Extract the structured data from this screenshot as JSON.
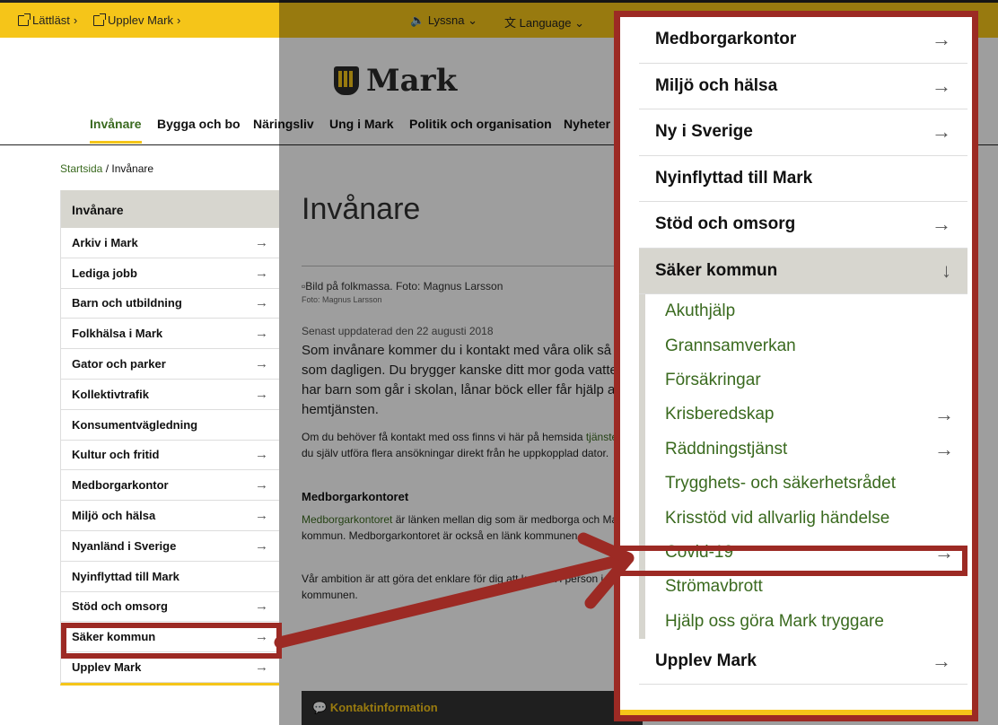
{
  "topbar": {
    "lattlast": "Lättläst",
    "upplev": "Upplev Mark",
    "lyssna": "Lyssna",
    "language": "Language"
  },
  "logo": {
    "name": "Mark"
  },
  "nav": [
    "Invånare",
    "Bygga och bo",
    "Näringsliv",
    "Ung i Mark",
    "Politik och organisation",
    "Nyheter"
  ],
  "breadcrumb": {
    "home": "Startsida",
    "current": "Invånare"
  },
  "sidebar": {
    "heading": "Invånare",
    "items": [
      {
        "label": "Arkiv i Mark",
        "arrow": true
      },
      {
        "label": "Lediga jobb",
        "arrow": true
      },
      {
        "label": "Barn och utbildning",
        "arrow": true
      },
      {
        "label": "Folkhälsa i Mark",
        "arrow": true
      },
      {
        "label": "Gator och parker",
        "arrow": true
      },
      {
        "label": "Kollektivtrafik",
        "arrow": true
      },
      {
        "label": "Konsumentvägledning",
        "arrow": false
      },
      {
        "label": "Kultur och fritid",
        "arrow": true
      },
      {
        "label": "Medborgarkontor",
        "arrow": true
      },
      {
        "label": "Miljö och hälsa",
        "arrow": true
      },
      {
        "label": "Nyanländ i Sverige",
        "arrow": true
      },
      {
        "label": "Nyinflyttad till Mark",
        "arrow": false
      },
      {
        "label": "Stöd och omsorg",
        "arrow": true
      },
      {
        "label": "Säker kommun",
        "arrow": true
      },
      {
        "label": "Upplev Mark",
        "arrow": true
      }
    ]
  },
  "content": {
    "title": "Invånare",
    "img_alt": "Bild på folkmassa. Foto: Magnus Larsson",
    "img_caption": "Foto: Magnus Larsson",
    "updated": "Senast uppdaterad den 22 augusti 2018",
    "lead": "Som invånare kommer du i kontakt med våra olik så gott som dagligen. Du brygger kanske ditt mor goda vatten, har barn som går i skolan, lånar böck eller får hjälp av hemtjänsten.",
    "p1_start": "Om du behöver få kontakt med oss finns vi här på hemsida",
    "p1_link": "tjänster",
    "p1_end": " kan du själv utföra flera ansökningar direkt från he uppkopplad dator.",
    "h3": "Medborgarkontoret",
    "p2_link": "Medborgarkontoret",
    "p2_rest": " är länken mellan dig som är medborga och Marks kommun. Medborgarkontoret är också en länk kommunen.",
    "p3": "Vår ambition är att göra det enklare för dig att komma i person i kommunen.",
    "kontakt": "Kontaktinformation"
  },
  "zoom": {
    "items": [
      {
        "label": "Medborgarkontor",
        "arrow": true
      },
      {
        "label": "Miljö och hälsa",
        "arrow": true
      },
      {
        "label": "Ny i Sverige",
        "arrow": true
      },
      {
        "label": "Nyinflyttad till Mark",
        "arrow": false
      },
      {
        "label": "Stöd och omsorg",
        "arrow": true
      }
    ],
    "open_item": "Säker kommun",
    "sub_items": [
      {
        "label": "Akuthjälp",
        "arrow": false
      },
      {
        "label": "Grannsamverkan",
        "arrow": false
      },
      {
        "label": "Försäkringar",
        "arrow": false
      },
      {
        "label": "Krisberedskap",
        "arrow": true
      },
      {
        "label": "Räddningstjänst",
        "arrow": true
      },
      {
        "label": "Trygghets- och säkerhetsrådet",
        "arrow": false
      },
      {
        "label": "Krisstöd vid allvarlig händelse",
        "arrow": false
      },
      {
        "label": "Covid-19",
        "arrow": true
      },
      {
        "label": "Strömavbrott",
        "arrow": false
      },
      {
        "label": "Hjälp oss göra Mark tryggare",
        "arrow": false
      }
    ],
    "last_item": "Upplev Mark"
  },
  "colors": {
    "yellow": "#f5c519",
    "green": "#3a6a1f",
    "highlight": "#9c2a24",
    "grey": "#d7d6cf"
  }
}
